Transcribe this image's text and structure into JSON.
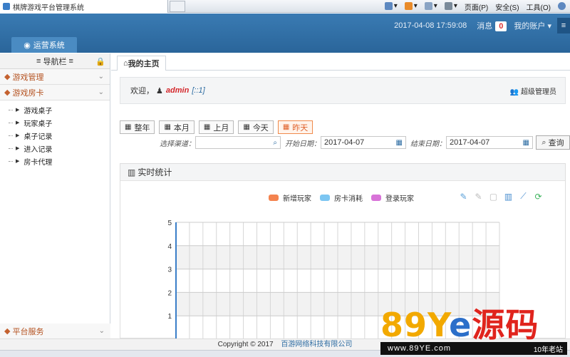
{
  "browser": {
    "tab_title": "棋牌游戏平台管理系统",
    "menus": [
      "页面(P)",
      "安全(S)",
      "工具(O)"
    ]
  },
  "header": {
    "system_tab": "运营系统",
    "datetime": "2017-04-08 17:59:08",
    "messages_label": "消息",
    "messages_count": "0",
    "account_label": "我的账户"
  },
  "sidebar": {
    "title": "导航栏",
    "groups": [
      {
        "label": "游戏管理"
      },
      {
        "label": "游戏房卡",
        "items": [
          "游戏桌子",
          "玩家桌子",
          "桌子记录",
          "进入记录",
          "房卡代理"
        ]
      },
      {
        "label": "平台服务"
      }
    ]
  },
  "main": {
    "home_tab": "我的主页",
    "welcome_prefix": "欢迎，",
    "username": "admin",
    "ip": "[::1]",
    "role": "超级管理员",
    "range_buttons": [
      "整年",
      "本月",
      "上月",
      "今天",
      "昨天"
    ],
    "active_range": "昨天",
    "channel_label": "选择渠道：",
    "channel_value": "",
    "start_label": "开始日期：",
    "start_date": "2017-04-07",
    "end_label": "结束日期：",
    "end_date": "2017-04-07",
    "query_button": "查询",
    "panel_title": "实时统计"
  },
  "chart_data": {
    "type": "line",
    "title": "",
    "series": [
      {
        "name": "新增玩家",
        "color": "#f4834f",
        "values": []
      },
      {
        "name": "房卡消耗",
        "color": "#7cc6f2",
        "values": []
      },
      {
        "name": "登录玩家",
        "color": "#d873d8",
        "values": []
      }
    ],
    "y_ticks": [
      1,
      2,
      3,
      4,
      5
    ],
    "ylim": [
      0,
      5
    ],
    "grid": true
  },
  "footer": {
    "copyright": "Copyright © 2017",
    "company": "百游网络科技有限公司"
  },
  "watermark": {
    "logo_text": "89Ye源码",
    "site": "www.89YE.com",
    "tag": "10年老站"
  }
}
